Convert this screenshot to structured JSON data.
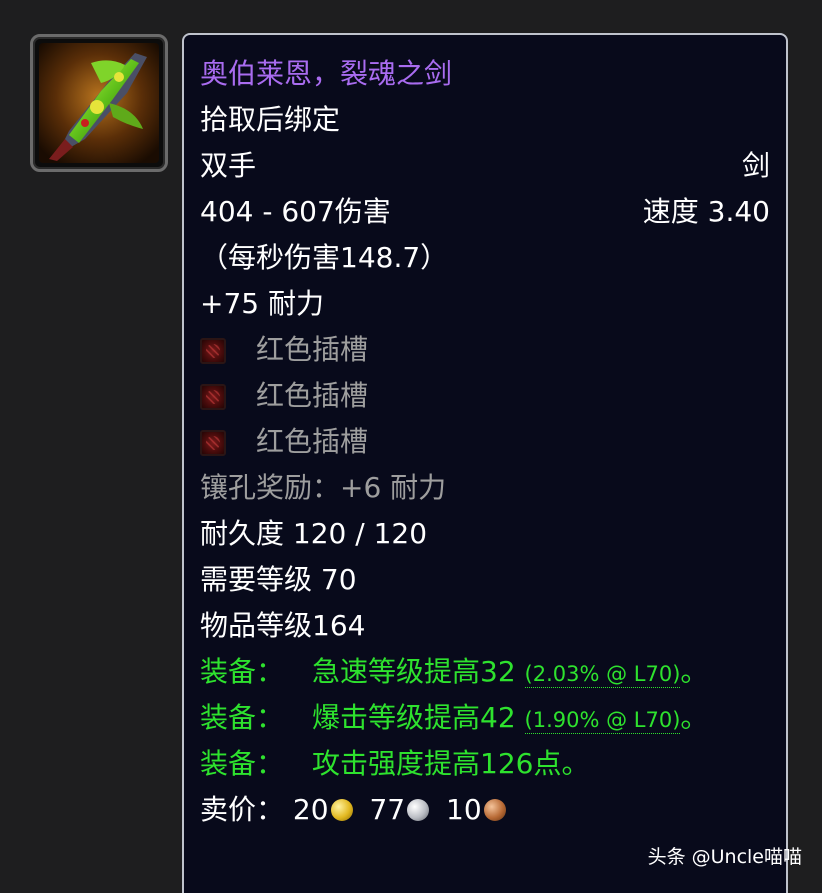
{
  "item": {
    "name": "奥伯莱恩，裂魂之剑",
    "binding": "拾取后绑定",
    "slot": "双手",
    "type": "剑",
    "damage": "404 - 607伤害",
    "speed": "速度 3.40",
    "dps": "（每秒伤害148.7）",
    "stamina": "+75 耐力",
    "sockets": [
      "红色插槽",
      "红色插槽",
      "红色插槽"
    ],
    "socket_bonus": "镶孔奖励：+6 耐力",
    "durability": "耐久度 120 / 120",
    "required_level": "需要等级 70",
    "item_level": "物品等级164",
    "equip_effects": [
      {
        "label": "装备：",
        "text": "急速等级提高32",
        "detail": "(2.03% @ L70)",
        "suffix": "。"
      },
      {
        "label": "装备：",
        "text": "爆击等级提高42",
        "detail": "(1.90% @ L70)",
        "suffix": "。"
      },
      {
        "label": "装备：",
        "text": "攻击强度提高126点。",
        "detail": "",
        "suffix": ""
      }
    ],
    "sell_price": {
      "label": "卖价：",
      "gold": "20",
      "silver": "77",
      "copper": "10"
    }
  },
  "icon": "sword-item-icon",
  "colors": {
    "name": "#a96cf0",
    "equip": "#2ee22e",
    "gray": "#9e9e9e",
    "tooltip_bg": "#080a1b"
  },
  "watermark": "头条 @Uncle喵喵"
}
